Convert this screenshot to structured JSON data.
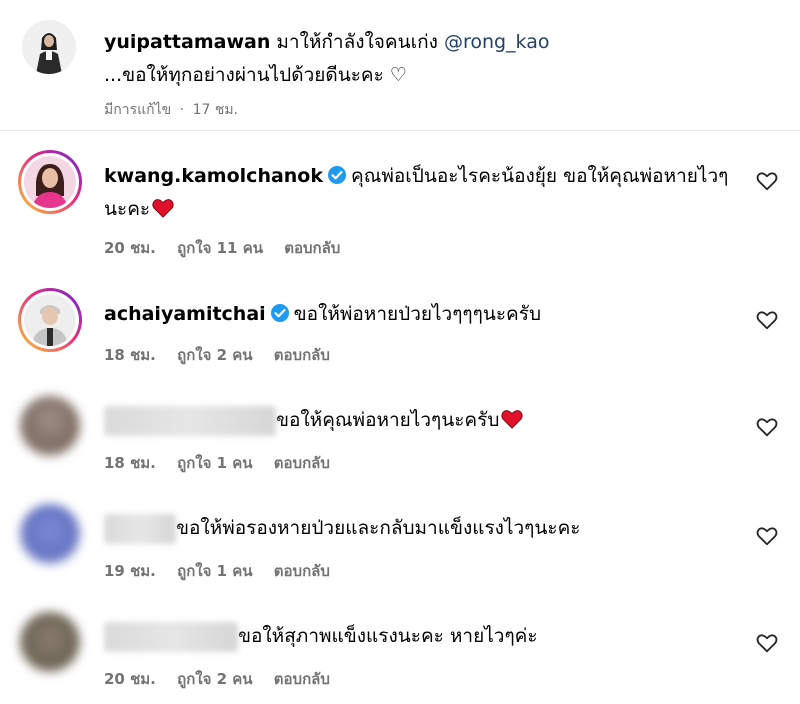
{
  "post": {
    "username": "yuipattamawan",
    "text": "มาให้กำลังใจคนเก่ง",
    "mention": "@rong_kao",
    "text2": "...ขอให้ทุกอย่างผ่านไปด้วยดีนะคะ ♡",
    "edited_label": "มีการแก้ไข",
    "separator": "·",
    "time": "17 ชม."
  },
  "comments": [
    {
      "username": "kwang.kamolchanok",
      "verified": true,
      "text": "คุณพ่อเป็นอะไรคะน้องยุ้ย ขอให้คุณพ่อหายไวๆนะคะ",
      "heart_emoji": true,
      "time": "20 ชม.",
      "likes": "ถูกใจ 11 คน",
      "reply": "ตอบกลับ"
    },
    {
      "username": "achaiyamitchai",
      "verified": true,
      "text": "ขอให้พ่อหายป่วยไวๆๆๆนะครับ",
      "heart_emoji": false,
      "time": "18 ชม.",
      "likes": "ถูกใจ 2 คน",
      "reply": "ตอบกลับ"
    },
    {
      "username": "",
      "verified": false,
      "text": "ขอให้คุณพ่อหายไวๆนะครับ",
      "heart_emoji": true,
      "time": "18 ชม.",
      "likes": "ถูกใจ 1 คน",
      "reply": "ตอบกลับ"
    },
    {
      "username": "",
      "verified": false,
      "text": "ขอให้พ่อรองหายป่วยและกลับมาแข็งแรงไวๆนะคะ",
      "heart_emoji": false,
      "time": "19 ชม.",
      "likes": "ถูกใจ 1 คน",
      "reply": "ตอบกลับ"
    },
    {
      "username": "",
      "verified": false,
      "text": "ขอให้สุภาพแข็งแรงนะคะ หายไวๆค่ะ",
      "heart_emoji": false,
      "time": "20 ชม.",
      "likes": "ถูกใจ 2 คน",
      "reply": "ตอบกลับ"
    }
  ],
  "colors": {
    "verified_blue": "#1d9bf0",
    "heart_red": "#e0112b",
    "meta_gray": "#737373",
    "mention_blue": "#23406b"
  }
}
